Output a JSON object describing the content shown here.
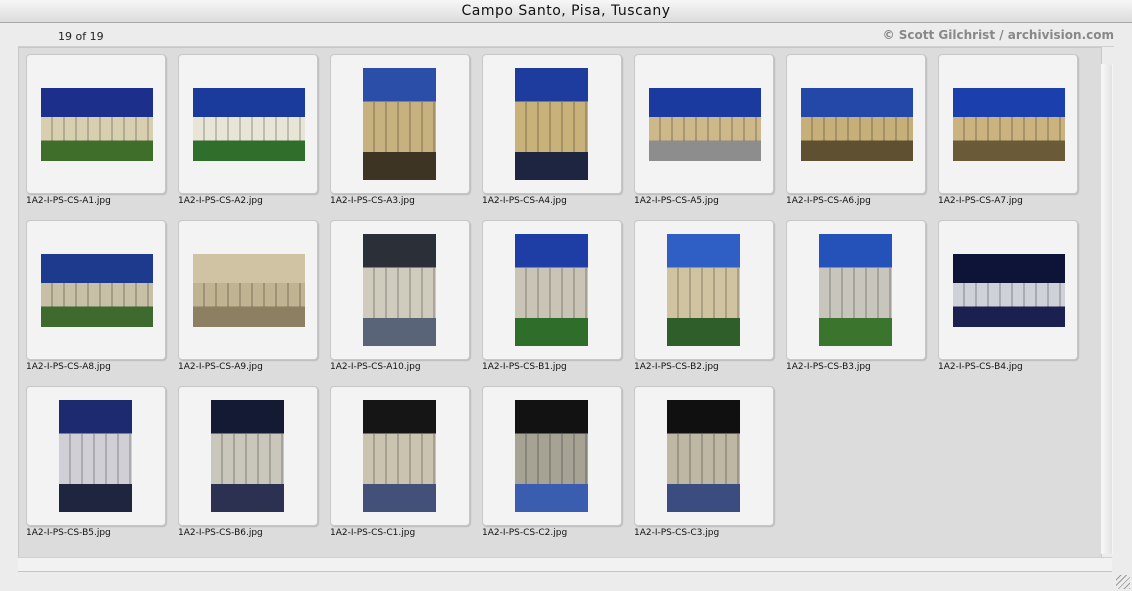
{
  "window": {
    "title": "Campo Santo, Pisa, Tuscany"
  },
  "toolbar": {
    "counter": "19 of 19",
    "credit": "© Scott Gilchrist / archivision.com"
  },
  "thumbnails": [
    {
      "filename": "1A2-I-PS-CS-A1.jpg",
      "orient": "landscape",
      "colors": [
        "#1c2f8a",
        "#d8cfb0",
        "#3f6d2a"
      ]
    },
    {
      "filename": "1A2-I-PS-CS-A2.jpg",
      "orient": "landscape",
      "colors": [
        "#1a3a9c",
        "#e8e4d6",
        "#2f6e2b"
      ]
    },
    {
      "filename": "1A2-I-PS-CS-A3.jpg",
      "orient": "portrait",
      "colors": [
        "#2b4ea8",
        "#c7b27f",
        "#3e3424"
      ]
    },
    {
      "filename": "1A2-I-PS-CS-A4.jpg",
      "orient": "portrait",
      "colors": [
        "#1e3c9e",
        "#c9b27a",
        "#1d2540"
      ]
    },
    {
      "filename": "1A2-I-PS-CS-A5.jpg",
      "orient": "landscape",
      "colors": [
        "#1a3aa0",
        "#cdb88a",
        "#8d8d8d"
      ]
    },
    {
      "filename": "1A2-I-PS-CS-A6.jpg",
      "orient": "landscape",
      "colors": [
        "#2448a8",
        "#c7af7a",
        "#5e5030"
      ]
    },
    {
      "filename": "1A2-I-PS-CS-A7.jpg",
      "orient": "landscape",
      "colors": [
        "#1c3fae",
        "#cbb380",
        "#6b5a38"
      ]
    },
    {
      "filename": "1A2-I-PS-CS-A8.jpg",
      "orient": "landscape",
      "colors": [
        "#1e3a8c",
        "#c7c0a6",
        "#3e6a2d"
      ]
    },
    {
      "filename": "1A2-I-PS-CS-A9.jpg",
      "orient": "landscape",
      "colors": [
        "#cfc3a3",
        "#c0b392",
        "#8d7f62"
      ]
    },
    {
      "filename": "1A2-I-PS-CS-A10.jpg",
      "orient": "portrait",
      "colors": [
        "#2b2f38",
        "#cfcbbd",
        "#5a6478"
      ]
    },
    {
      "filename": "1A2-I-PS-CS-B1.jpg",
      "orient": "portrait",
      "colors": [
        "#1e3ea5",
        "#c9c4b5",
        "#2f6d2a"
      ]
    },
    {
      "filename": "1A2-I-PS-CS-B2.jpg",
      "orient": "portrait",
      "colors": [
        "#2f5fc5",
        "#cfc3a0",
        "#305e2a"
      ]
    },
    {
      "filename": "1A2-I-PS-CS-B3.jpg",
      "orient": "portrait",
      "colors": [
        "#2552b8",
        "#c8c6bc",
        "#3b742c"
      ]
    },
    {
      "filename": "1A2-I-PS-CS-B4.jpg",
      "orient": "landscape",
      "colors": [
        "#0e1338",
        "#cfd1d8",
        "#1a2050"
      ]
    },
    {
      "filename": "1A2-I-PS-CS-B5.jpg",
      "orient": "portrait",
      "colors": [
        "#1d2a70",
        "#cfcfd5",
        "#20253f"
      ]
    },
    {
      "filename": "1A2-I-PS-CS-B6.jpg",
      "orient": "portrait",
      "colors": [
        "#141a33",
        "#c9c6bb",
        "#2c3152"
      ]
    },
    {
      "filename": "1A2-I-PS-CS-C1.jpg",
      "orient": "portrait",
      "colors": [
        "#151515",
        "#c9c3b0",
        "#42507a"
      ]
    },
    {
      "filename": "1A2-I-PS-CS-C2.jpg",
      "orient": "portrait",
      "colors": [
        "#121212",
        "#a6a395",
        "#3b5db0"
      ]
    },
    {
      "filename": "1A2-I-PS-CS-C3.jpg",
      "orient": "portrait",
      "colors": [
        "#101010",
        "#bdb7a4",
        "#3a4c80"
      ]
    }
  ]
}
